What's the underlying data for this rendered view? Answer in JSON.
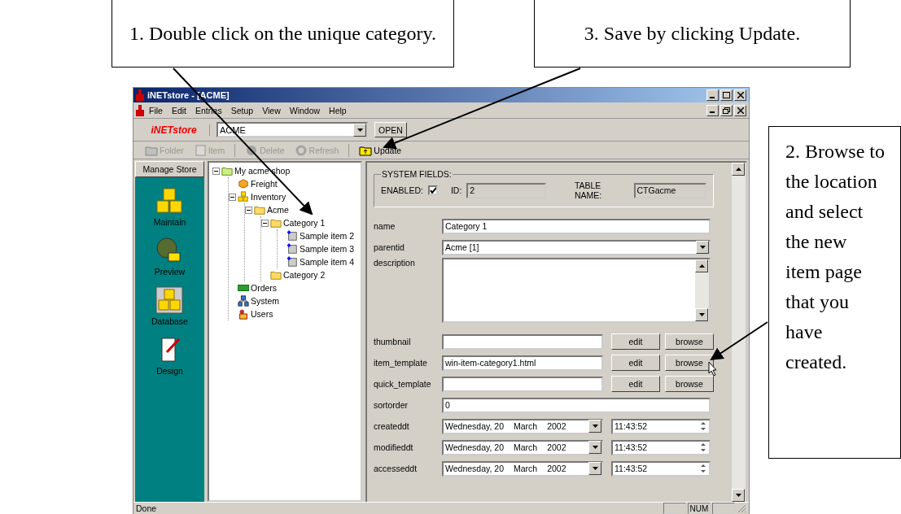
{
  "callouts": [
    {
      "text": "1. Double click on the unique category."
    },
    {
      "text": "3. Save by clicking Update."
    },
    {
      "text": "2. Browse to the location and select the new item page that you have created."
    }
  ],
  "window": {
    "title": "iNETstore - [ACME]",
    "menu": [
      "File",
      "Edit",
      "Entries",
      "Setup",
      "View",
      "Window",
      "Help"
    ],
    "logo": "iNETstore",
    "store_combo": {
      "value": "ACME"
    },
    "open_button": "OPEN",
    "toolbar": [
      {
        "kind": "folder",
        "label": "Folder",
        "disabled": true
      },
      {
        "kind": "item",
        "label": "Item",
        "disabled": true
      },
      {
        "kind": "delete",
        "label": "Delete",
        "disabled": true
      },
      {
        "kind": "refresh",
        "label": "Refresh",
        "disabled": true
      },
      {
        "kind": "update",
        "label": "Update",
        "disabled": false
      }
    ],
    "sidebar": {
      "header": "Manage Store",
      "items": [
        {
          "kind": "maintain",
          "label": "Maintain"
        },
        {
          "kind": "preview",
          "label": "Preview"
        },
        {
          "kind": "database",
          "label": "Database"
        },
        {
          "kind": "design",
          "label": "Design"
        }
      ]
    },
    "tree": [
      {
        "kind": "open-folder",
        "label": "My acme shop",
        "expanded": true,
        "children": [
          {
            "kind": "box",
            "label": "Freight"
          },
          {
            "kind": "cubes",
            "label": "Inventory",
            "expanded": true,
            "children": [
              {
                "kind": "folder",
                "label": "Acme",
                "expanded": true,
                "children": [
                  {
                    "kind": "folder",
                    "label": "Category 1",
                    "expanded": true,
                    "children": [
                      {
                        "kind": "item",
                        "label": "Sample item 2"
                      },
                      {
                        "kind": "item",
                        "label": "Sample item 3"
                      },
                      {
                        "kind": "item",
                        "label": "Sample item 4"
                      }
                    ]
                  },
                  {
                    "kind": "folder",
                    "label": "Category 2"
                  }
                ]
              }
            ]
          },
          {
            "kind": "orders",
            "label": "Orders"
          },
          {
            "kind": "system",
            "label": "System"
          },
          {
            "kind": "users",
            "label": "Users"
          }
        ]
      }
    ],
    "system_fields": {
      "legend": "SYSTEM FIELDS:",
      "enabled_label": "ENABLED:",
      "enabled": true,
      "id_label": "ID:",
      "id": "2",
      "table_label": "TABLE NAME:",
      "table": "CTGacme"
    },
    "fields": [
      {
        "kind": "text",
        "label": "name",
        "value": "Category 1"
      },
      {
        "kind": "select",
        "label": "parentid",
        "value": "Acme [1]"
      },
      {
        "kind": "textarea",
        "label": "description"
      },
      {
        "kind": "file",
        "label": "thumbnail",
        "buttons": [
          "edit",
          "browse"
        ]
      },
      {
        "kind": "file",
        "label": "item_template",
        "value": "win-item-category1.html",
        "buttons": [
          "edit",
          "browse"
        ]
      },
      {
        "kind": "file",
        "label": "quick_template",
        "buttons": [
          "edit",
          "browse"
        ]
      },
      {
        "kind": "text",
        "label": "sortorder",
        "value": "0"
      },
      {
        "kind": "datetime",
        "label": "createddt",
        "date": [
          "Wednesday, 20",
          "March",
          "2002"
        ],
        "time": "11:43:52"
      },
      {
        "kind": "datetime",
        "label": "modifieddt",
        "date": [
          "Wednesday, 20",
          "March",
          "2002"
        ],
        "time": "11:43:52"
      },
      {
        "kind": "datetime",
        "label": "accesseddt",
        "date": [
          "Wednesday, 20",
          "March",
          "2002"
        ],
        "time": "11:43:52"
      }
    ],
    "status_bar": {
      "text": "Done",
      "indicator": "NUM"
    }
  }
}
